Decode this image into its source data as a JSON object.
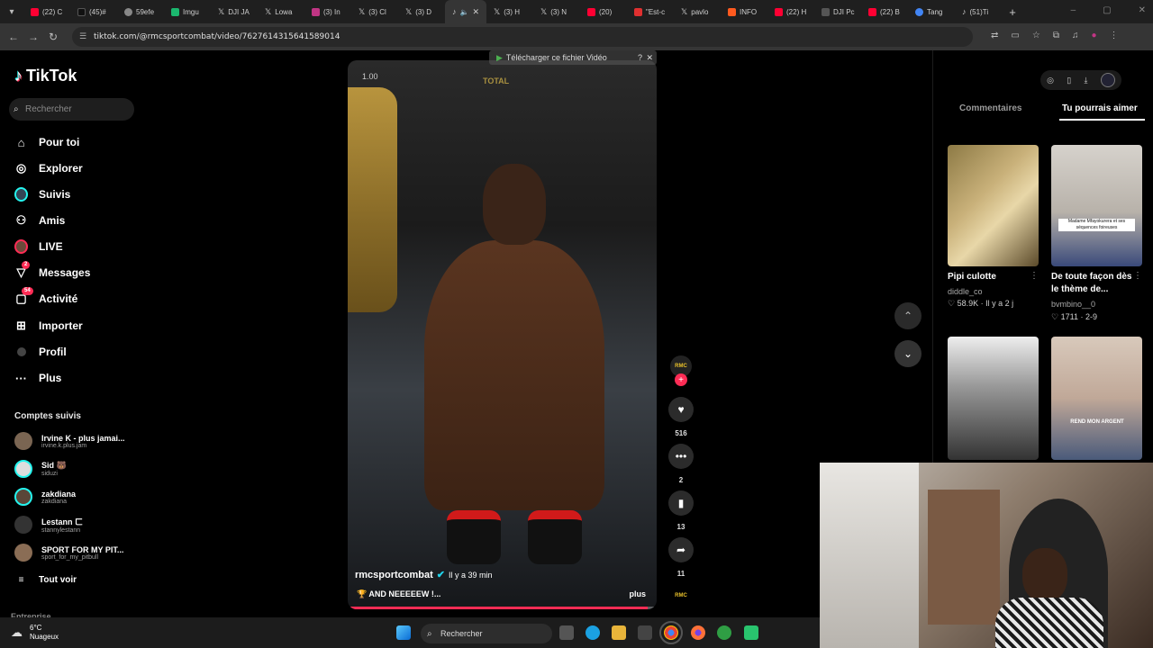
{
  "browser": {
    "tabs": [
      {
        "label": "(22) C",
        "color": "#ff0033"
      },
      {
        "label": "(45)#",
        "color": "#000000"
      },
      {
        "label": "59efe",
        "color": "#888888"
      },
      {
        "label": "Imgu",
        "color": "#1bb76e"
      },
      {
        "label": "DJI JA",
        "color": "#222222"
      },
      {
        "label": "Lowa",
        "color": "#222222"
      },
      {
        "label": "(3) In",
        "color": "#c13584"
      },
      {
        "label": "(3) Cl",
        "color": "#222222"
      },
      {
        "label": "(3) D",
        "color": "#222222"
      },
      {
        "label": "",
        "color": "#000000"
      },
      {
        "label": "(3) H",
        "color": "#222222"
      },
      {
        "label": "(3) N",
        "color": "#222222"
      },
      {
        "label": "(20)",
        "color": "#ff0033"
      },
      {
        "label": "\"Est-c",
        "color": "#e03030"
      },
      {
        "label": "pavlo",
        "color": "#222222"
      },
      {
        "label": "INFO",
        "color": "#ff5a1f"
      },
      {
        "label": "(22) H",
        "color": "#ff0033"
      },
      {
        "label": "DJI Pc",
        "color": "#555555"
      },
      {
        "label": "(22) B",
        "color": "#ff0033"
      },
      {
        "label": "Tang",
        "color": "#4285f4"
      },
      {
        "label": "(51)Ti",
        "color": "#000000"
      }
    ],
    "url": "tiktok.com/@rmcsportcombat/video/7627614315641589014",
    "download_banner": "Télécharger ce fichier Vidéo"
  },
  "sidebar": {
    "logo": "TikTok",
    "search_placeholder": "Rechercher",
    "nav": [
      {
        "label": "Pour toi",
        "icon": "home-icon",
        "glyph": "⌂"
      },
      {
        "label": "Explorer",
        "icon": "compass-icon",
        "glyph": "◎"
      },
      {
        "label": "Suivis",
        "icon": "following-avatar-icon",
        "glyph": "●"
      },
      {
        "label": "Amis",
        "icon": "friends-icon",
        "glyph": "⚇"
      },
      {
        "label": "LIVE",
        "icon": "live-icon",
        "glyph": "●"
      },
      {
        "label": "Messages",
        "icon": "messages-icon",
        "glyph": "▽",
        "badge": "2"
      },
      {
        "label": "Activité",
        "icon": "activity-icon",
        "glyph": "▢",
        "badge": "54"
      },
      {
        "label": "Importer",
        "icon": "upload-icon",
        "glyph": "⊞"
      },
      {
        "label": "Profil",
        "icon": "profile-icon",
        "glyph": "●"
      },
      {
        "label": "Plus",
        "icon": "more-icon",
        "glyph": "···"
      }
    ],
    "followed_title": "Comptes suivis",
    "followed": [
      {
        "name": "Irvine K - plus jamai...",
        "handle": "irvine.k.plus.jam"
      },
      {
        "name": "Sid 🐻",
        "handle": "siduzi"
      },
      {
        "name": "zakdiana",
        "handle": "zakdiana"
      },
      {
        "name": "Lestann ㄈ",
        "handle": "stannylestann"
      },
      {
        "name": "SPORT FOR MY PIT...",
        "handle": "sport_for_my_pitbull"
      }
    ],
    "see_all": "Tout voir",
    "footer": "Entreprise"
  },
  "video": {
    "speed": "1.00",
    "author": "rmcsportcombat",
    "time": "Il y a 39 min",
    "caption": "AND NEEEEEW !...",
    "more": "plus",
    "overlay_brand": "TOTAL",
    "progress": 0.97
  },
  "actions": {
    "likes": "516",
    "comments": "2",
    "saves": "13",
    "shares": "11"
  },
  "right_panel": {
    "tab_comments": "Commentaires",
    "tab_suggestions": "Tu pourrais aimer",
    "cards": [
      {
        "title": "Pipi culotte",
        "user": "diddle_co",
        "likes": "58.9K",
        "age": "Il y a 2 j"
      },
      {
        "title": "De toute façon dès le thème de...",
        "user": "bvmbino__0",
        "likes": "1711",
        "age": "2-9",
        "overlay": "Madame Mfayokurera et ses séquences foireuses"
      },
      {
        "title": "",
        "user": "",
        "likes": "",
        "age": ""
      },
      {
        "title": "",
        "user": "",
        "likes": "",
        "age": "",
        "overlay": "REND MON ARGENT"
      }
    ]
  },
  "taskbar": {
    "weather_temp": "6°C",
    "weather_desc": "Nuageux",
    "search": "Rechercher"
  }
}
